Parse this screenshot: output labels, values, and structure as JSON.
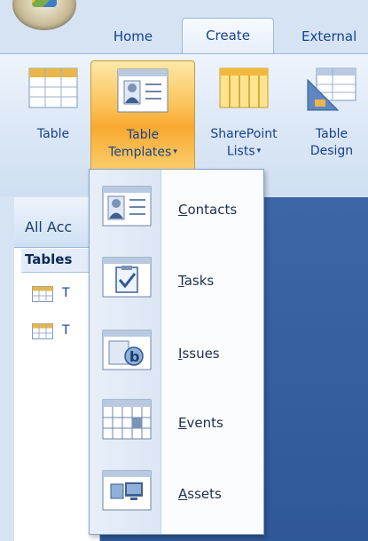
{
  "tabs": {
    "home": "Home",
    "create": "Create",
    "external": "External"
  },
  "ribbon": {
    "table": "Table",
    "table_templates_line1": "Table",
    "table_templates_line2": "Templates",
    "sharepoint_line1": "SharePoint",
    "sharepoint_line2": "Lists",
    "table_design_line1": "Table",
    "table_design_line2": "Design"
  },
  "nav_pane": {
    "title": "All Acc",
    "group": "Tables",
    "items": [
      {
        "label": "T",
        "icon": "table-icon"
      },
      {
        "label": "T",
        "icon": "table-icon"
      }
    ]
  },
  "menu": {
    "items": [
      {
        "key": "C",
        "rest": "ontacts",
        "icon": "contacts-icon"
      },
      {
        "key": "T",
        "rest": "asks",
        "icon": "tasks-icon"
      },
      {
        "key": "I",
        "rest": "ssues",
        "icon": "issues-icon"
      },
      {
        "key": "E",
        "rest": "vents",
        "icon": "events-icon"
      },
      {
        "key": "A",
        "rest": "ssets",
        "icon": "assets-icon"
      }
    ]
  },
  "colors": {
    "ribbon_bg": "#dbe7f6",
    "text_blue": "#15428b",
    "highlight_orange": "#f9a930",
    "workspace_blue": "#2f5896"
  }
}
